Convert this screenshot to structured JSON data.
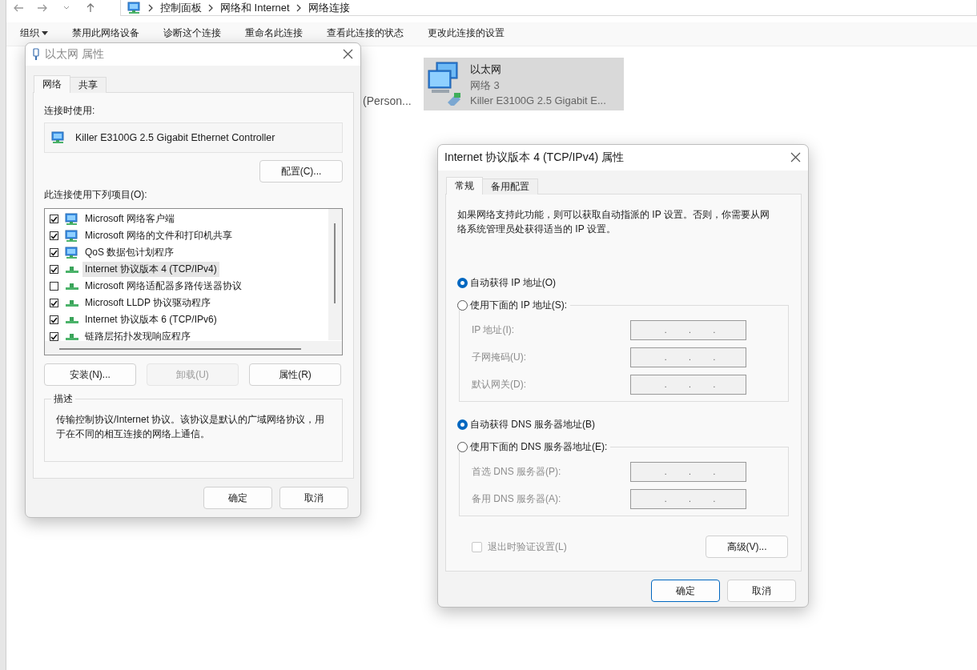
{
  "explorer": {
    "breadcrumb": [
      "控制面板",
      "网络和 Internet",
      "网络连接"
    ],
    "toolbar": [
      {
        "label": "组织",
        "kind": "menu"
      },
      {
        "label": "禁用此网络设备",
        "kind": "command"
      },
      {
        "label": "诊断这个连接",
        "kind": "command"
      },
      {
        "label": "重命名此连接",
        "kind": "command"
      },
      {
        "label": "查看此连接的状态",
        "kind": "command"
      },
      {
        "label": "更改此连接的设置",
        "kind": "command"
      }
    ],
    "partial_item": "(Person...",
    "connections": [
      {
        "name": "以太网",
        "network": "网络 3",
        "adapter": "Killer E3100G 2.5 Gigabit E...",
        "selected": true
      }
    ]
  },
  "ethernet_dialog": {
    "title": "以太网 属性",
    "tabs": [
      {
        "label": "网络",
        "selected": true
      },
      {
        "label": "共享",
        "selected": false
      }
    ],
    "connect_using_label": "连接时使用:",
    "adapter": "Killer E3100G 2.5 Gigabit Ethernet Controller",
    "configure_button": "配置(C)...",
    "items_label": "此连接使用下列项目(O):",
    "items": [
      {
        "label": "Microsoft 网络客户端",
        "checked": true,
        "selected": false,
        "kind": "client"
      },
      {
        "label": "Microsoft 网络的文件和打印机共享",
        "checked": true,
        "selected": false,
        "kind": "service"
      },
      {
        "label": "QoS 数据包计划程序",
        "checked": true,
        "selected": false,
        "kind": "service"
      },
      {
        "label": "Internet 协议版本 4 (TCP/IPv4)",
        "checked": true,
        "selected": true,
        "kind": "protocol"
      },
      {
        "label": "Microsoft 网络适配器多路传送器协议",
        "checked": false,
        "selected": false,
        "kind": "protocol"
      },
      {
        "label": "Microsoft LLDP 协议驱动程序",
        "checked": true,
        "selected": false,
        "kind": "protocol"
      },
      {
        "label": "Internet 协议版本 6 (TCP/IPv6)",
        "checked": true,
        "selected": false,
        "kind": "protocol"
      },
      {
        "label": "链路层拓扑发现响应程序",
        "checked": true,
        "selected": false,
        "kind": "protocol"
      }
    ],
    "item_buttons": [
      {
        "label": "安装(N)...",
        "disabled": false
      },
      {
        "label": "卸载(U)",
        "disabled": true
      },
      {
        "label": "属性(R)",
        "disabled": false
      }
    ],
    "description_title": "描述",
    "description": "传输控制协议/Internet 协议。该协议是默认的广域网络协议，用于在不同的相互连接的网络上通信。",
    "footer": [
      {
        "label": "确定",
        "default": false
      },
      {
        "label": "取消",
        "default": false
      }
    ]
  },
  "ipv4_dialog": {
    "title": "Internet 协议版本 4 (TCP/IPv4) 属性",
    "tabs": [
      {
        "label": "常规",
        "selected": true
      },
      {
        "label": "备用配置",
        "selected": false
      }
    ],
    "intro": "如果网络支持此功能，则可以获取自动指派的 IP 设置。否则，你需要从网络系统管理员处获得适当的 IP 设置。",
    "sections": [
      {
        "options": [
          {
            "label": "自动获得 IP 地址(O)",
            "selected": true
          },
          {
            "label": "使用下面的 IP 地址(S):",
            "selected": false
          }
        ],
        "fields": [
          {
            "label": "IP 地址(I):",
            "dots": [
              ".",
              ".",
              "."
            ],
            "disabled": true
          },
          {
            "label": "子网掩码(U):",
            "dots": [
              ".",
              ".",
              "."
            ],
            "disabled": true
          },
          {
            "label": "默认网关(D):",
            "dots": [
              ".",
              ".",
              "."
            ],
            "disabled": true
          }
        ]
      },
      {
        "options": [
          {
            "label": "自动获得 DNS 服务器地址(B)",
            "selected": true
          },
          {
            "label": "使用下面的 DNS 服务器地址(E):",
            "selected": false
          }
        ],
        "fields": [
          {
            "label": "首选 DNS 服务器(P):",
            "dots": [
              ".",
              ".",
              "."
            ],
            "disabled": true
          },
          {
            "label": "备用 DNS 服务器(A):",
            "dots": [
              ".",
              ".",
              "."
            ],
            "disabled": true
          }
        ]
      }
    ],
    "validate": {
      "label": "退出时验证设置(L)",
      "checked": false,
      "disabled": true
    },
    "advanced_button": "高级(V)...",
    "footer": [
      {
        "label": "确定",
        "default": true
      },
      {
        "label": "取消",
        "default": false
      }
    ]
  }
}
